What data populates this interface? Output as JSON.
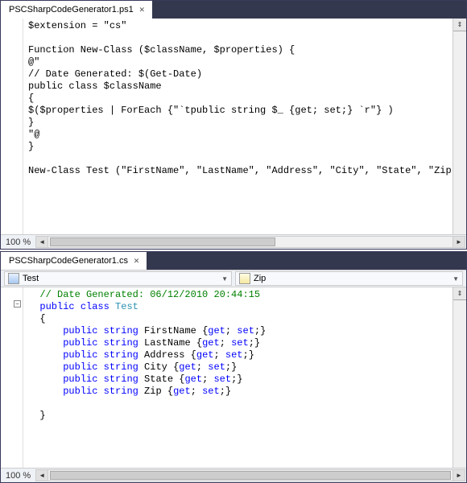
{
  "top": {
    "tab_title": "PSCSharpCodeGenerator1.ps1",
    "zoom": "100 %",
    "code": "$extension = \"cs\"\n\nFunction New-Class ($className, $properties) {\n@\"\n// Date Generated: $(Get-Date)\npublic class $className\n{\n$($properties | ForEach {\"`tpublic string $_ {get; set;} `r\"} )\n}\n\"@\n}\n\nNew-Class Test (\"FirstName\", \"LastName\", \"Address\", \"City\", \"State\", \"Zip\")"
  },
  "bottom": {
    "tab_title": "PSCSharpCodeGenerator1.cs",
    "zoom": "100 %",
    "dropdown_left": "Test",
    "dropdown_right": "Zip",
    "code": {
      "comment": "// Date Generated: 06/12/2010 20:44:15",
      "decl_kw1": "public",
      "decl_kw2": "class",
      "decl_name": "Test",
      "open": "{",
      "props": [
        {
          "kw1": "public",
          "kw2": "string",
          "name": "FirstName",
          "acc": "{get; set;}"
        },
        {
          "kw1": "public",
          "kw2": "string",
          "name": "LastName",
          "acc": "{get; set;}"
        },
        {
          "kw1": "public",
          "kw2": "string",
          "name": "Address",
          "acc": "{get; set;}"
        },
        {
          "kw1": "public",
          "kw2": "string",
          "name": "City",
          "acc": "{get; set;}"
        },
        {
          "kw1": "public",
          "kw2": "string",
          "name": "State",
          "acc": "{get; set;}"
        },
        {
          "kw1": "public",
          "kw2": "string",
          "name": "Zip",
          "acc": "{get; set;}"
        }
      ],
      "close": "}"
    }
  }
}
